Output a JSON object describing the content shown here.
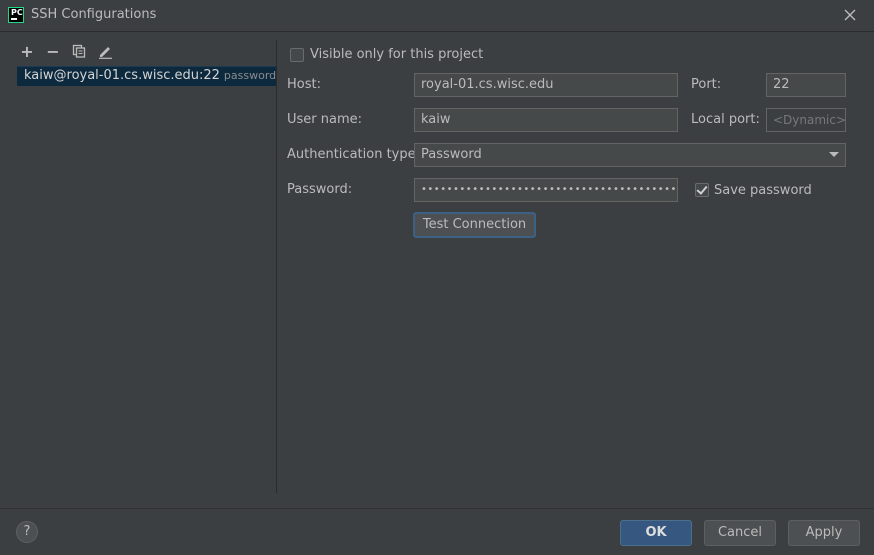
{
  "window": {
    "title": "SSH Configurations",
    "app_badge": "PC"
  },
  "toolbar": {
    "add": "+",
    "remove": "−",
    "copy_icon": "copy-icon",
    "edit_icon": "pencil-icon"
  },
  "configurations": [
    {
      "label": "kaiw@royal-01.cs.wisc.edu:22",
      "auth": "password",
      "selected": true
    }
  ],
  "form": {
    "visible_only_label": "Visible only for this project",
    "visible_only_checked": false,
    "host_label": "Host:",
    "host_value": "royal-01.cs.wisc.edu",
    "port_label": "Port:",
    "port_value": "22",
    "username_label": "User name:",
    "username_value": "kaiw",
    "local_port_label": "Local port:",
    "local_port_placeholder": "<Dynamic>",
    "auth_type_label": "Authentication type:",
    "auth_type_value": "Password",
    "password_label": "Password:",
    "password_value": "••••••••••••••••••••••••••••••••••••••••••",
    "save_password_label": "Save password",
    "save_password_checked": true,
    "test_connection_label": "Test Connection"
  },
  "footer": {
    "help": "?",
    "ok": "OK",
    "cancel": "Cancel",
    "apply": "Apply"
  },
  "colors": {
    "background": "#3c3f41",
    "selection": "#0d293e",
    "primary_button": "#365880"
  }
}
